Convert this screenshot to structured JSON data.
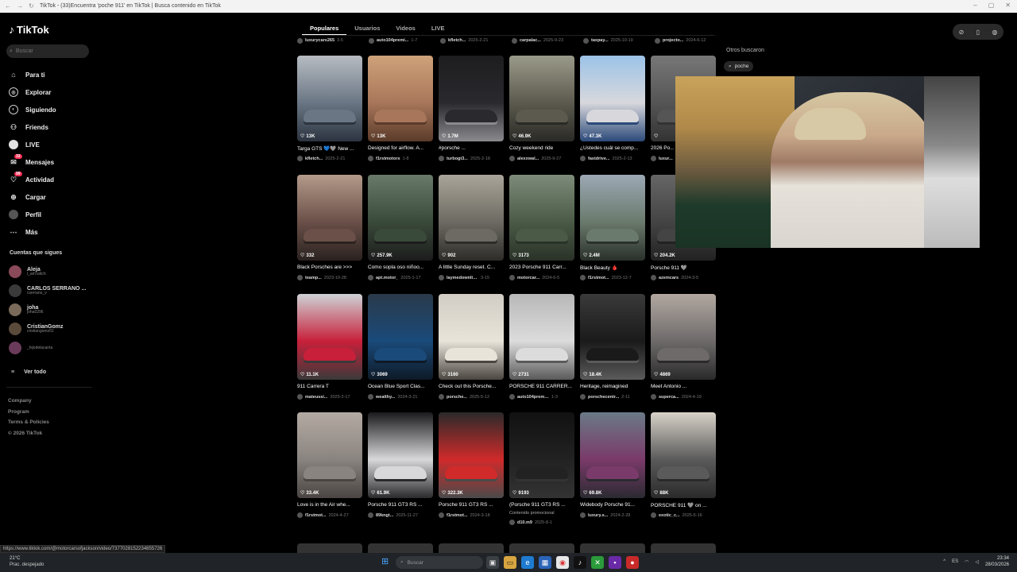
{
  "browser": {
    "title": "TikTok - (33)Encuentra 'poche 911' en TikTok | Busca contenido en TikTok"
  },
  "sidebar": {
    "logo": "TikTok",
    "search_placeholder": "Buscar",
    "nav": [
      {
        "label": "Para ti",
        "icon": "home-icon"
      },
      {
        "label": "Explorar",
        "icon": "compass-icon"
      },
      {
        "label": "Siguiendo",
        "icon": "following-icon"
      },
      {
        "label": "Friends",
        "icon": "friends-icon"
      },
      {
        "label": "LIVE",
        "icon": "live-icon"
      },
      {
        "label": "Mensajes",
        "icon": "messages-icon",
        "badge": "33"
      },
      {
        "label": "Actividad",
        "icon": "activity-icon",
        "badge": "99"
      },
      {
        "label": "Cargar",
        "icon": "upload-icon"
      },
      {
        "label": "Perfil",
        "icon": "profile-icon"
      },
      {
        "label": "Más",
        "icon": "more-icon"
      }
    ],
    "following_title": "Cuentas que sigues",
    "following": [
      {
        "name": "Aleja",
        "handle": "i_am.witch"
      },
      {
        "name": "CARLOS SERRANO ...",
        "handle": "cserrano_v"
      },
      {
        "name": "joha",
        "handle": "joha0296"
      },
      {
        "name": "CristianGomz",
        "handle": "cristiangomz01"
      },
      {
        "name": "",
        "handle": "_hijodelacanta"
      }
    ],
    "see_all": "Ver todo",
    "footer": [
      "Company",
      "Program",
      "Terms & Policies",
      "© 2026 TikTok"
    ]
  },
  "tabs": [
    {
      "label": "Populares",
      "active": true
    },
    {
      "label": "Usuarios",
      "active": false
    },
    {
      "label": "Videos",
      "active": false
    },
    {
      "label": "LIVE",
      "active": false
    }
  ],
  "top_meta": [
    {
      "user": "luxurycars265",
      "date": "3-5"
    },
    {
      "user": "auto104premi...",
      "date": "1-7"
    },
    {
      "user": "kfletch...",
      "date": "2025-2-21"
    },
    {
      "user": "carpalac...",
      "date": "2025-9-23"
    },
    {
      "user": "taxpay...",
      "date": "2025-10-19"
    },
    {
      "user": "projecto...",
      "date": "2024-6-12"
    }
  ],
  "videos": [
    {
      "views": "13K",
      "caption": "Targa GTS 💙🩶 New ...",
      "user": "kfletch...",
      "date": "2025-2-21",
      "colors": [
        "#b7bcc2",
        "#6a7684",
        "#2c3440"
      ]
    },
    {
      "views": "13K",
      "caption": "Designed for airflow. A...",
      "user": "f1rstmotors",
      "date": "1-8",
      "colors": [
        "#cfa27a",
        "#a8765a",
        "#5a3b2a"
      ]
    },
    {
      "views": "1.7M",
      "caption": "#porsche ...",
      "user": "turbogt3...",
      "date": "2025-2-18",
      "colors": [
        "#1d1d20",
        "#2a2a2e",
        "#8a8a8e"
      ]
    },
    {
      "views": "46.9K",
      "caption": "Cozy weekend ride",
      "user": "alexxwal...",
      "date": "2025-9-27",
      "colors": [
        "#9a9a8a",
        "#5c5a4e",
        "#2a2a26"
      ]
    },
    {
      "views": "47.3K",
      "caption": "¿Ustedes cuál se comp...",
      "user": "fastdrive...",
      "date": "2025-2-13",
      "colors": [
        "#9cc3e8",
        "#d8d8dc",
        "#2c4a7a"
      ]
    },
    {
      "views": "",
      "caption": "2026 Po...",
      "user": "luxur...",
      "date": "",
      "colors": [
        "#777",
        "#555",
        "#333"
      ]
    },
    {
      "views": "332",
      "caption": "Black Porsches are >>>",
      "user": "teamp...",
      "date": "2023-10-28",
      "colors": [
        "#b49a8a",
        "#6a5048",
        "#2a2220"
      ]
    },
    {
      "views": "257.9K",
      "caption": "Como sopla oso niñoo...",
      "user": "apt.motor_",
      "date": "2025-1-17",
      "colors": [
        "#6a7a6a",
        "#3a4a3a",
        "#1c1c1c"
      ]
    },
    {
      "views": "902",
      "caption": "A little Sunday reset. C...",
      "user": "laymedownliam",
      "date": "3-15",
      "colors": [
        "#aaa59a",
        "#6c6a62",
        "#2e2c28"
      ]
    },
    {
      "views": "3173",
      "caption": "2023 Porsche 911 Carr...",
      "user": "motorcar...",
      "date": "2024-6-5",
      "colors": [
        "#7d8c7a",
        "#4a5a46",
        "#2a3228"
      ]
    },
    {
      "views": "2.4M",
      "caption": "Black Beauty 🩸",
      "user": "f1rstmot...",
      "date": "2023-12-7",
      "colors": [
        "#9ca8b4",
        "#6a7a6c",
        "#2a302a"
      ]
    },
    {
      "views": "204.2K",
      "caption": "Porsche 911 🩶",
      "user": "azemcars",
      "date": "2024-3-5",
      "colors": [
        "#666",
        "#444",
        "#222"
      ]
    },
    {
      "views": "11.1K",
      "caption": "911 Carrera T",
      "user": "mateussi...",
      "date": "2025-2-17",
      "colors": [
        "#cdd2d6",
        "#c8203a",
        "#3a3a3a"
      ]
    },
    {
      "views": "3069",
      "caption": "Ocean Blue Sport Clas...",
      "user": "wealthy...",
      "date": "2024-3-21",
      "colors": [
        "#2a3a4a",
        "#1a4a7a",
        "#0e1a26"
      ]
    },
    {
      "views": "3160",
      "caption": "Check out this Porsche...",
      "user": "porsche...",
      "date": "2025-5-12",
      "colors": [
        "#d2cdc4",
        "#e8e4da",
        "#4a4640"
      ]
    },
    {
      "views": "2731",
      "caption": "PORSCHE 911 CARRER...",
      "user": "auto104premi...",
      "date": "1-3",
      "colors": [
        "#b8b8b8",
        "#dcdcdc",
        "#5a5a5a"
      ]
    },
    {
      "views": "18.4K",
      "caption": "Heritage, reimagined",
      "user": "porschecentr...",
      "date": "2-11",
      "colors": [
        "#3a3a3a",
        "#1a1a1a",
        "#5a5a5a"
      ]
    },
    {
      "views": "4869",
      "caption": "Meet Antonio ...",
      "user": "superca...",
      "date": "2024-4-19",
      "colors": [
        "#b2a8a0",
        "#6e6a6a",
        "#2a2a2a"
      ]
    },
    {
      "views": "33.4K",
      "caption": "Love is in the Air whe...",
      "user": "f1rstmot...",
      "date": "2024-4-27",
      "colors": [
        "#b4aaa2",
        "#8a8480",
        "#4a4442"
      ]
    },
    {
      "views": "61.9K",
      "caption": "Porsche 911 GT3 RS ...",
      "user": "89kngt...",
      "date": "2025-11-27",
      "colors": [
        "#1a1a1c",
        "#d8d8da",
        "#2a2a2c"
      ]
    },
    {
      "views": "322.3K",
      "caption": "Porsche 911 GT3 RS ...",
      "user": "f1rstmot...",
      "date": "2024-3-18",
      "colors": [
        "#2a2a2a",
        "#d02a2a",
        "#4a4a4a"
      ]
    },
    {
      "views": "9193",
      "caption": "(Porsche 911 GT3 RS ...",
      "user": "d10.m9",
      "date": "2025-8-1",
      "promo": "Contenido promocional",
      "colors": [
        "#111",
        "#222",
        "#333"
      ]
    },
    {
      "views": "69.8K",
      "caption": "Widebody Porsche 91...",
      "user": "luxury.s...",
      "date": "2024-2-28",
      "colors": [
        "#6a7a86",
        "#7a3a6a",
        "#2a2a30"
      ]
    },
    {
      "views": "88K",
      "caption": "PORSCHE 911 🩶 on ...",
      "user": "exotic_c...",
      "date": "2025-6-16",
      "colors": [
        "#d8d2c8",
        "#5a5a5a",
        "#2a2a2a"
      ]
    }
  ],
  "right_panel": {
    "others_title": "Otros buscaron",
    "suggestion": "poche"
  },
  "status_url": "https://www.tiktok.com/@motorcarsofjackson/video/7377028152234855726",
  "taskbar": {
    "weather_temp": "21°C",
    "weather_desc": "Prac. despejado",
    "search_placeholder": "Buscar",
    "time": "23:34",
    "date": "28/03/2026",
    "language": "ES"
  }
}
